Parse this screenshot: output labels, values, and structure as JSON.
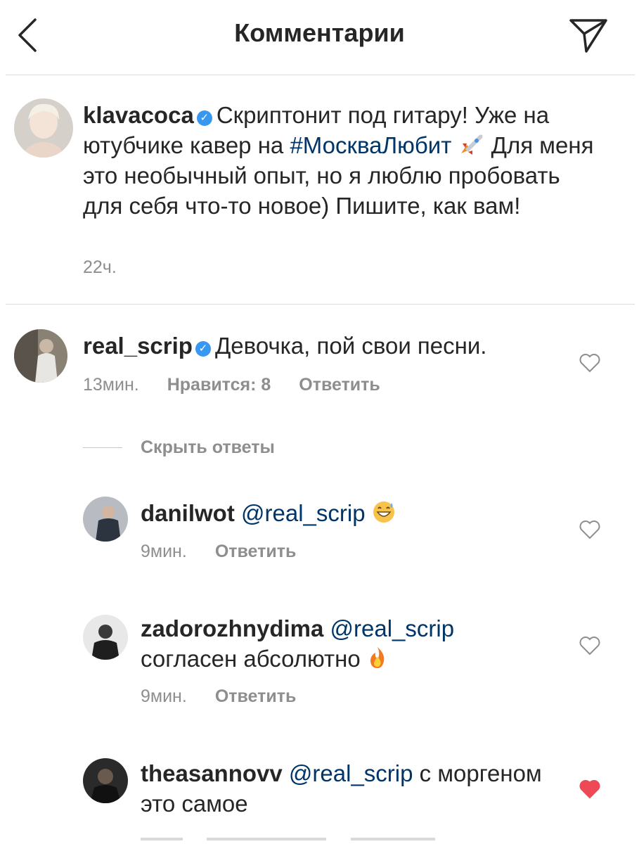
{
  "header": {
    "title": "Комментарии",
    "back_icon": "chevron-left-icon",
    "send_icon": "paper-plane-icon"
  },
  "post": {
    "username": "klavacoca",
    "text_part1": "Скриптонит под гитару! Уже на ютубчике кавер на ",
    "hashtag": "#МоскваЛюбит",
    "emoji": "rocket",
    "text_part2": " Для меня это необычный опыт, но я люблю пробовать для себя что-то новое) Пишите, как вам!",
    "time": "22ч."
  },
  "comment": {
    "username": "real_scrip",
    "text": "Девочка, пой свои песни.",
    "time": "13мин.",
    "likes": "Нравится: 8",
    "reply": "Ответить"
  },
  "hide_replies": "Скрыть ответы",
  "replies": [
    {
      "username": "danilwot",
      "mention": "@real_scrip",
      "text": "",
      "emoji": "grinning-sweat",
      "time": "9мин.",
      "reply": "Ответить",
      "liked": false
    },
    {
      "username": "zadorozhnydima",
      "mention": "@real_scrip",
      "text": "согласен абсолютно",
      "emoji": "fire",
      "time": "9мин.",
      "reply": "Ответить",
      "liked": false
    },
    {
      "username": "theasannovv",
      "mention": "@real_scrip",
      "text": "с моргеном это самое",
      "emoji": "",
      "time": "",
      "reply": "",
      "liked": true
    }
  ],
  "colors": {
    "accent": "#3897f0",
    "link": "#003569",
    "meta": "#8e8e8e",
    "heart_liked": "#ed4956"
  }
}
